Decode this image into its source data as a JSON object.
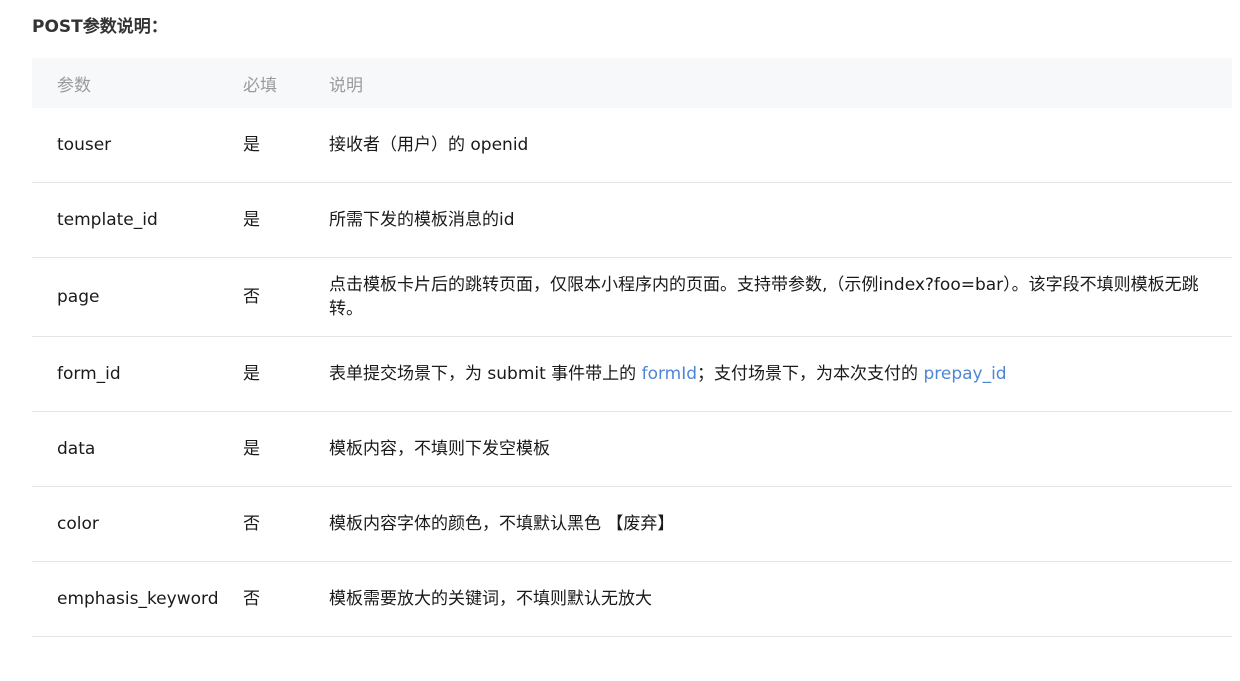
{
  "title": "POST参数说明：",
  "headers": [
    "参数",
    "必填",
    "说明"
  ],
  "rows": [
    {
      "name": "touser",
      "required": "是",
      "desc": [
        "接收者（用户）的 openid"
      ]
    },
    {
      "name": "template_id",
      "required": "是",
      "desc": [
        "所需下发的模板消息的id"
      ]
    },
    {
      "name": "page",
      "required": "否",
      "desc": [
        "点击模板卡片后的跳转页面，仅限本小程序内的页面。支持带参数,（示例index?foo=bar）。该字段不填则模板无跳转。"
      ]
    },
    {
      "name": "form_id",
      "required": "是",
      "desc": [
        "表单提交场景下，为 submit 事件带上的 ",
        "formId",
        "；支付场景下，为本次支付的 ",
        "prepay_id"
      ]
    },
    {
      "name": "data",
      "required": "是",
      "desc": [
        "模板内容，不填则下发空模板"
      ]
    },
    {
      "name": "color",
      "required": "否",
      "desc": [
        "模板内容字体的颜色，不填默认黑色 【废弃】"
      ]
    },
    {
      "name": "emphasis_keyword",
      "required": "否",
      "desc": [
        "模板需要放大的关键词，不填则默认无放大"
      ]
    }
  ],
  "colors": {
    "link": "#4e86d6"
  }
}
